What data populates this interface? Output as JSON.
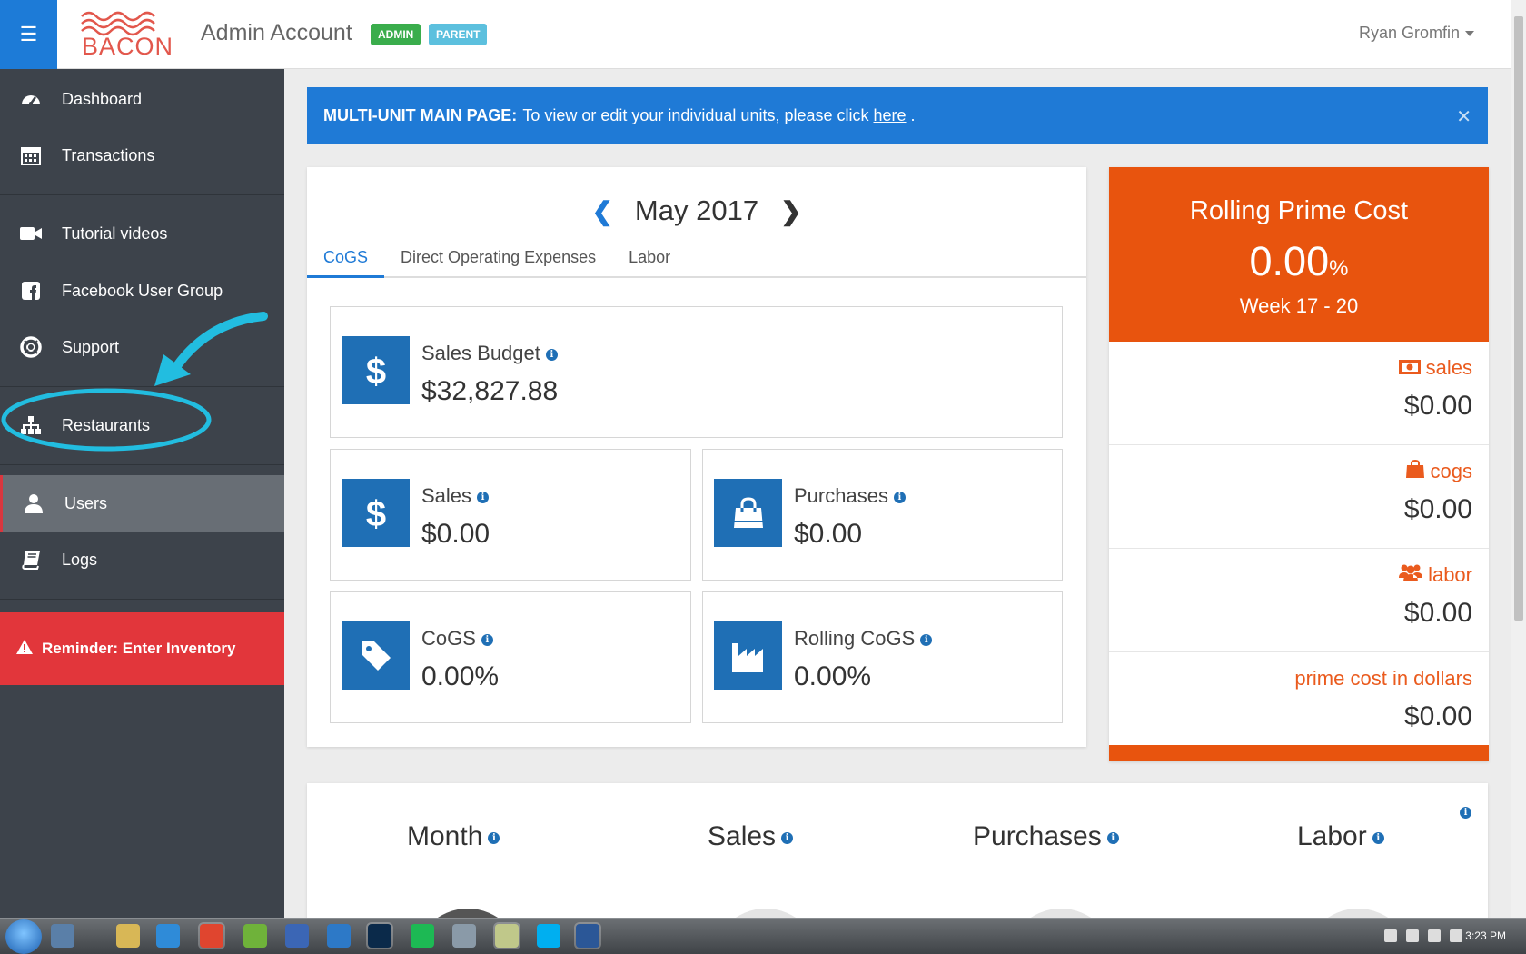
{
  "header": {
    "logo_text": "BACON",
    "title": "Admin Account",
    "badges": [
      "ADMIN",
      "PARENT"
    ],
    "user_name": "Ryan Gromfin"
  },
  "sidebar": {
    "items": [
      {
        "label": "Dashboard",
        "icon": "dashboard-icon"
      },
      {
        "label": "Transactions",
        "icon": "calendar-icon"
      },
      {
        "label": "Tutorial videos",
        "icon": "video-camera-icon"
      },
      {
        "label": "Facebook User Group",
        "icon": "facebook-icon"
      },
      {
        "label": "Support",
        "icon": "life-ring-icon"
      },
      {
        "label": "Restaurants",
        "icon": "sitemap-icon"
      },
      {
        "label": "Users",
        "icon": "user-icon",
        "active": true
      },
      {
        "label": "Logs",
        "icon": "book-icon"
      }
    ],
    "reminder": "Reminder: Enter Inventory"
  },
  "alert": {
    "bold": "MULTI-UNIT MAIN PAGE:",
    "text": "To view or edit your individual units, please click",
    "link": "here",
    "suffix": "."
  },
  "main": {
    "month": "May 2017",
    "tabs": [
      "CoGS",
      "Direct Operating Expenses",
      "Labor"
    ],
    "stats": {
      "sales_budget": {
        "label": "Sales Budget",
        "value": "$32,827.88"
      },
      "sales": {
        "label": "Sales",
        "value": "$0.00"
      },
      "purchases": {
        "label": "Purchases",
        "value": "$0.00"
      },
      "cogs": {
        "label": "CoGS",
        "value": "0.00%"
      },
      "rolling_cogs": {
        "label": "Rolling CoGS",
        "value": "0.00%"
      }
    }
  },
  "prime": {
    "title": "Rolling Prime Cost",
    "value": "0.00",
    "unit": "%",
    "week": "Week 17 - 20",
    "rows": [
      {
        "label": "sales",
        "value": "$0.00",
        "icon": "money-icon"
      },
      {
        "label": "cogs",
        "value": "$0.00",
        "icon": "shopping-bag-icon"
      },
      {
        "label": "labor",
        "value": "$0.00",
        "icon": "users-icon"
      },
      {
        "label": "prime cost in dollars",
        "value": "$0.00",
        "icon": ""
      }
    ]
  },
  "lower": {
    "columns": [
      "Month",
      "Sales",
      "Purchases",
      "Labor"
    ]
  },
  "taskbar": {
    "clock": "3:23 PM"
  },
  "colors": {
    "accent_blue": "#1f7ad6",
    "sidebar_bg": "#3d434b",
    "reminder_red": "#e2363b",
    "prime_orange": "#e8540e",
    "stat_icon_blue": "#1f6fb5"
  }
}
